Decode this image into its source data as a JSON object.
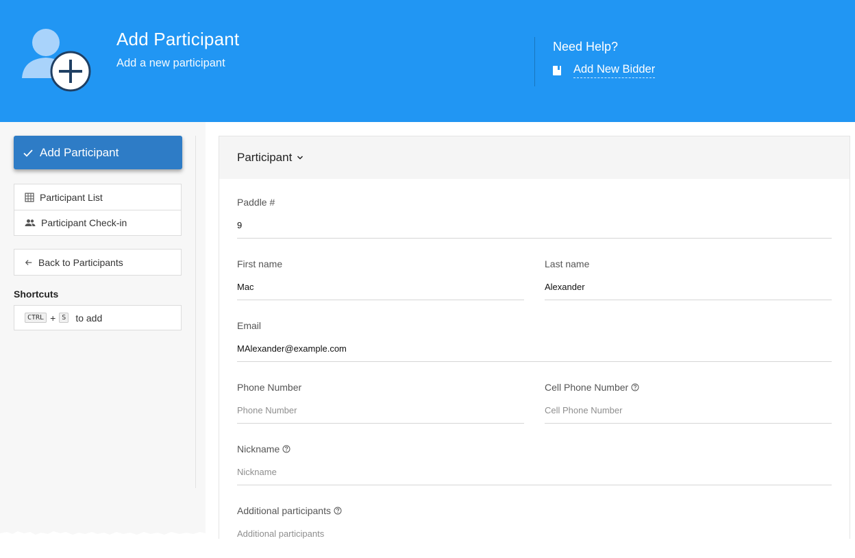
{
  "header": {
    "title": "Add Participant",
    "subtitle": "Add a new participant",
    "help_title": "Need Help?",
    "help_link": "Add New Bidder",
    "color": "#2196f3"
  },
  "sidebar": {
    "primary_button": "Add Participant",
    "nav": [
      {
        "label": "Participant List",
        "icon": "grid-icon"
      },
      {
        "label": "Participant Check-in",
        "icon": "people-icon"
      }
    ],
    "back": {
      "label": "Back to Participants",
      "icon": "arrow-left-icon"
    },
    "shortcuts_title": "Shortcuts",
    "shortcut": {
      "key1": "CTRL",
      "plus": "+",
      "key2": "S",
      "text": "to add"
    }
  },
  "form": {
    "section_title": "Participant",
    "paddle": {
      "label": "Paddle #",
      "value": "9"
    },
    "first_name": {
      "label": "First name",
      "value": "Mac"
    },
    "last_name": {
      "label": "Last name",
      "value": "Alexander"
    },
    "email": {
      "label": "Email",
      "value": "MAlexander@example.com"
    },
    "phone": {
      "label": "Phone Number",
      "placeholder": "Phone Number"
    },
    "cell_phone": {
      "label": "Cell Phone Number",
      "placeholder": "Cell Phone Number"
    },
    "nickname": {
      "label": "Nickname",
      "placeholder": "Nickname"
    },
    "additional": {
      "label": "Additional participants",
      "placeholder": "Additional participants"
    }
  }
}
